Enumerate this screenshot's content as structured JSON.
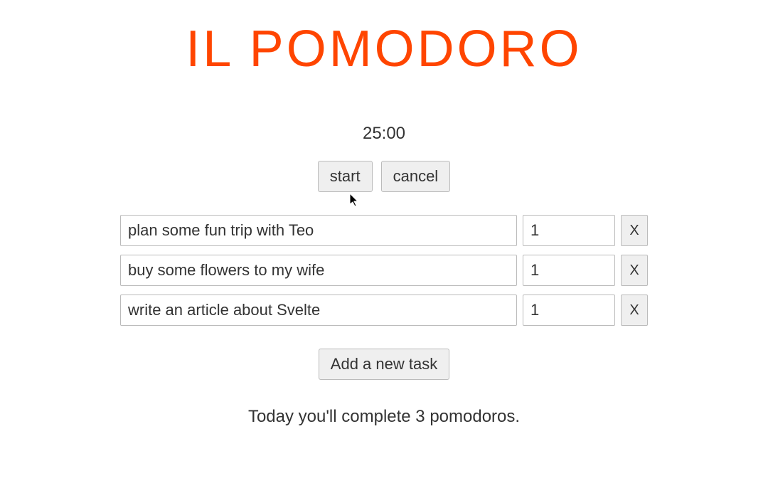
{
  "app": {
    "title": "IL POMODORO"
  },
  "timer": {
    "display": "25:00",
    "start_label": "start",
    "cancel_label": "cancel"
  },
  "tasks": [
    {
      "name": "plan some fun trip with Teo",
      "count": "1",
      "delete_label": "X"
    },
    {
      "name": "buy some flowers to my wife",
      "count": "1",
      "delete_label": "X"
    },
    {
      "name": "write an article about Svelte",
      "count": "1",
      "delete_label": "X"
    }
  ],
  "add_task_label": "Add a new task",
  "summary": "Today you'll complete 3 pomodoros."
}
